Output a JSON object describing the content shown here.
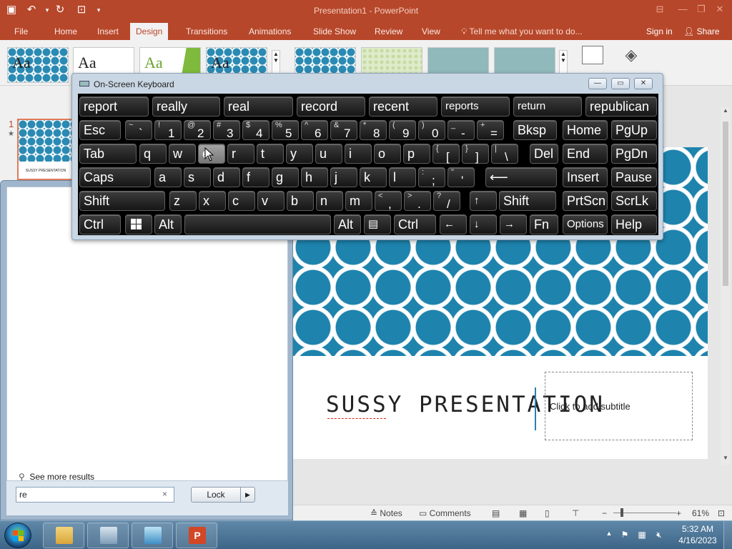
{
  "powerpoint": {
    "window_title": "Presentation1 - PowerPoint",
    "tabs": [
      "File",
      "Home",
      "Insert",
      "Design",
      "Transitions",
      "Animations",
      "Slide Show",
      "Review",
      "View"
    ],
    "active_tab": "Design",
    "tell_me": "Tell me what you want to do...",
    "sign_in": "Sign in",
    "share": "Share",
    "theme_samples": [
      "Aa",
      "Aa",
      "Aa",
      "Aa"
    ],
    "slide_number": "1",
    "slide_star": "★",
    "thumb_title": "SUSSY PRESENTATION",
    "slide_title": "SUSSY PRESENTATION",
    "subtitle_placeholder": "Click to add subtitle",
    "status": {
      "notes": "Notes",
      "comments": "Comments",
      "zoom": "61%"
    },
    "colors": {
      "accent": "#b7472a",
      "slide_blue": "#1e83ad"
    }
  },
  "start_menu": {
    "see_more": "See more results",
    "search_value": "re",
    "clear_glyph": "×",
    "lock_button": "Lock",
    "lock_arrow": "▶"
  },
  "osk": {
    "title": "On-Screen Keyboard",
    "controls": [
      "—",
      "▭",
      "✕"
    ],
    "predictions": [
      "report",
      "really",
      "real",
      "record",
      "recent",
      "reports",
      "return",
      "republican"
    ],
    "number_row": [
      {
        "s": "~",
        "b": "`"
      },
      {
        "s": "!",
        "b": "1"
      },
      {
        "s": "@",
        "b": "2"
      },
      {
        "s": "#",
        "b": "3"
      },
      {
        "s": "$",
        "b": "4"
      },
      {
        "s": "%",
        "b": "5"
      },
      {
        "s": "^",
        "b": "6"
      },
      {
        "s": "&",
        "b": "7"
      },
      {
        "s": "*",
        "b": "8"
      },
      {
        "s": "(",
        "b": "9"
      },
      {
        "s": ")",
        "b": "0"
      },
      {
        "s": "_",
        "b": "-"
      },
      {
        "s": "+",
        "b": "="
      }
    ],
    "row_q": [
      "q",
      "w",
      "e",
      "r",
      "t",
      "y",
      "u",
      "i",
      "o",
      "p"
    ],
    "row_q_brackets": [
      {
        "s": "{",
        "b": "["
      },
      {
        "s": "}",
        "b": "]"
      },
      {
        "s": "|",
        "b": "\\"
      }
    ],
    "row_a": [
      "a",
      "s",
      "d",
      "f",
      "g",
      "h",
      "j",
      "k",
      "l"
    ],
    "row_a_punct": [
      {
        "s": ":",
        "b": ";"
      },
      {
        "s": "\"",
        "b": "'"
      }
    ],
    "row_z": [
      "z",
      "x",
      "c",
      "v",
      "b",
      "n",
      "m"
    ],
    "row_z_punct": [
      {
        "s": "<",
        "b": ","
      },
      {
        "s": ">",
        "b": "."
      },
      {
        "s": "?",
        "b": "/"
      }
    ],
    "labels": {
      "esc": "Esc",
      "bksp": "Bksp",
      "home": "Home",
      "pgup": "PgUp",
      "tab": "Tab",
      "del": "Del",
      "end": "End",
      "pgdn": "PgDn",
      "caps": "Caps",
      "enter": "⟵",
      "insert": "Insert",
      "pause": "Pause",
      "shift": "Shift",
      "up": "↑",
      "prtscn": "PrtScn",
      "scrlk": "ScrLk",
      "ctrl": "Ctrl",
      "alt": "Alt",
      "menu": "▤",
      "left": "←",
      "down": "↓",
      "right": "→",
      "fn": "Fn",
      "options": "Options",
      "help": "Help"
    }
  },
  "taskbar": {
    "time": "5:32 AM",
    "date": "4/16/2023",
    "tray_arrow": "▲"
  }
}
